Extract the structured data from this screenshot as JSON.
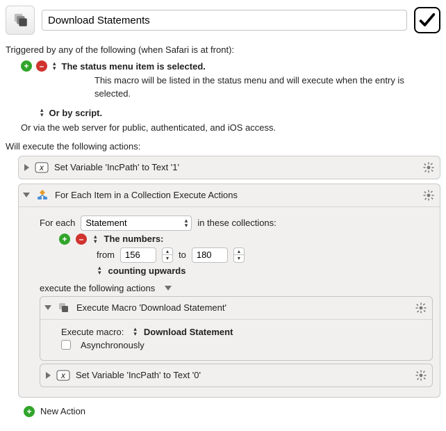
{
  "header": {
    "macro_name": "Download Statements"
  },
  "triggers": {
    "lead": "Triggered by any of the following (when Safari is at front):",
    "status_menu": {
      "label": "The status menu item is selected.",
      "desc": "This macro will be listed in the status menu and will execute when the entry is selected."
    },
    "or_script": "Or by script.",
    "webserver": "Or via the web server for public, authenticated, and iOS access."
  },
  "actions_lead": "Will execute the following actions:",
  "action_set_var1": {
    "title": "Set Variable 'IncPath' to Text '1'"
  },
  "foreach": {
    "title": "For Each Item in a Collection Execute Actions",
    "for_each_label": "For each",
    "variable": "Statement",
    "in_these": "in these collections:",
    "numbers_label": "The numbers:",
    "from_label": "from",
    "from_value": "156",
    "to_label": "to",
    "to_value": "180",
    "counting": "counting upwards",
    "execute_label": "execute the following actions",
    "child_execute_macro": {
      "title": "Execute Macro 'Download Statement'",
      "execute_macro_label": "Execute macro:",
      "macro_name": "Download Statement",
      "async_label": "Asynchronously"
    },
    "child_set_var": {
      "title": "Set Variable 'IncPath' to Text '0'"
    }
  },
  "new_action": "New Action"
}
